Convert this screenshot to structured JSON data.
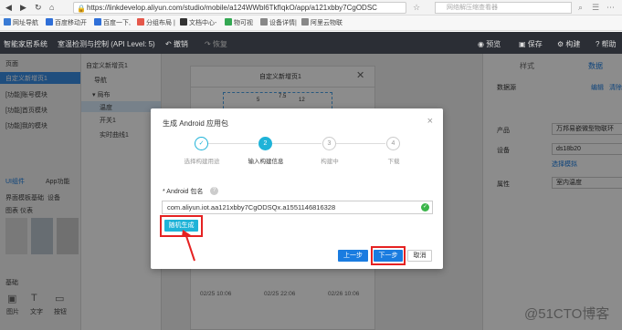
{
  "browser": {
    "url": "https://linkdevelop.aliyun.com/studio/mobile/a124WWbl6TkfIqkO/app/a121xbby7CgODSC",
    "search_placeholder": "网络解压缩查看器",
    "bookmarks": [
      "网址导航",
      "百度移动开",
      "百度一下,",
      "分组布局 |",
      "文档中心-",
      "物可视",
      "设备详情|",
      "阿里云物联"
    ]
  },
  "app_header": {
    "title": "智能家居系统",
    "page": "室温检测与控制 (API Level: 5)",
    "undo": "撤销",
    "redo": "恢复",
    "preview": "预览",
    "save": "保存",
    "build": "构建",
    "help": "帮助"
  },
  "left_panel": {
    "header": "页面",
    "pages": [
      "自定义新增页1",
      "[功能]账号模块",
      "[功能]首页模块",
      "[功能]我的模块"
    ],
    "tabs": [
      "UI组件",
      "App功能"
    ],
    "sub_tabs": [
      "界面模板",
      "基础",
      "设备"
    ],
    "sub_tabs2": [
      "图表",
      "仪表"
    ],
    "section": "基础",
    "components": [
      "图片",
      "文字",
      "按钮"
    ]
  },
  "tree": {
    "header": "自定义新增页1",
    "items": [
      "导航",
      "▾ 局布",
      "温度",
      "开关1",
      "实时曲线1"
    ]
  },
  "phone": {
    "title": "自定义新增页1",
    "dial_values": [
      "5",
      "7.5",
      "12"
    ],
    "times": [
      "02/25 10:06",
      "02/25 22:06",
      "02/26 10:06"
    ]
  },
  "right_panel": {
    "tabs": [
      "样式",
      "数据"
    ],
    "datasource_label": "数据源",
    "edit": "编辑",
    "clear": "清除",
    "product_label": "产品",
    "product_value": "万邦易嵌微型物联环",
    "device_label": "设备",
    "device_value": "ds18b20",
    "simulate": "选择模拟",
    "property_label": "属性",
    "property_value": "室内温度"
  },
  "modal": {
    "title": "生成 Android 应用包",
    "steps": [
      {
        "num": "✓",
        "label": "选择构建用途",
        "state": "done"
      },
      {
        "num": "2",
        "label": "输入构建信息",
        "state": "active"
      },
      {
        "num": "3",
        "label": "构建中",
        "state": "todo"
      },
      {
        "num": "4",
        "label": "下载",
        "state": "todo"
      }
    ],
    "field_label": "* Android 包名",
    "field_help": "?",
    "field_value": "com.aliyun.iot.aa121xbby7CgODSQx.a1551146816328",
    "generate_button": "随机生成",
    "prev_button": "上一步",
    "next_button": "下一步",
    "cancel_button": "取消"
  },
  "watermark": "@51CTO博客",
  "colors": {
    "accent": "#1fb3d8",
    "primary_btn": "#1a7ce0",
    "highlight": "#e52222",
    "header_bg": "#2b2e35"
  }
}
